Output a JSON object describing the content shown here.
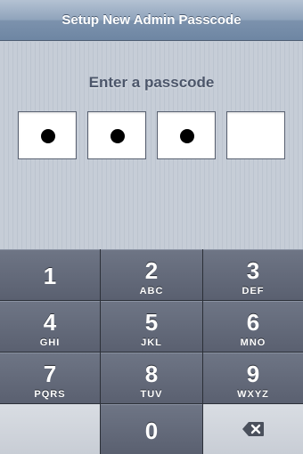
{
  "navbar": {
    "title": "Setup New Admin Passcode"
  },
  "prompt": "Enter a passcode",
  "passcode": {
    "length": 4,
    "entered": 3
  },
  "keys": [
    {
      "num": "1",
      "letters": ""
    },
    {
      "num": "2",
      "letters": "ABC"
    },
    {
      "num": "3",
      "letters": "DEF"
    },
    {
      "num": "4",
      "letters": "GHI"
    },
    {
      "num": "5",
      "letters": "JKL"
    },
    {
      "num": "6",
      "letters": "MNO"
    },
    {
      "num": "7",
      "letters": "PQRS"
    },
    {
      "num": "8",
      "letters": "TUV"
    },
    {
      "num": "9",
      "letters": "WXYZ"
    },
    {
      "num": "0",
      "letters": ""
    }
  ],
  "icons": {
    "delete": "backspace-icon"
  }
}
